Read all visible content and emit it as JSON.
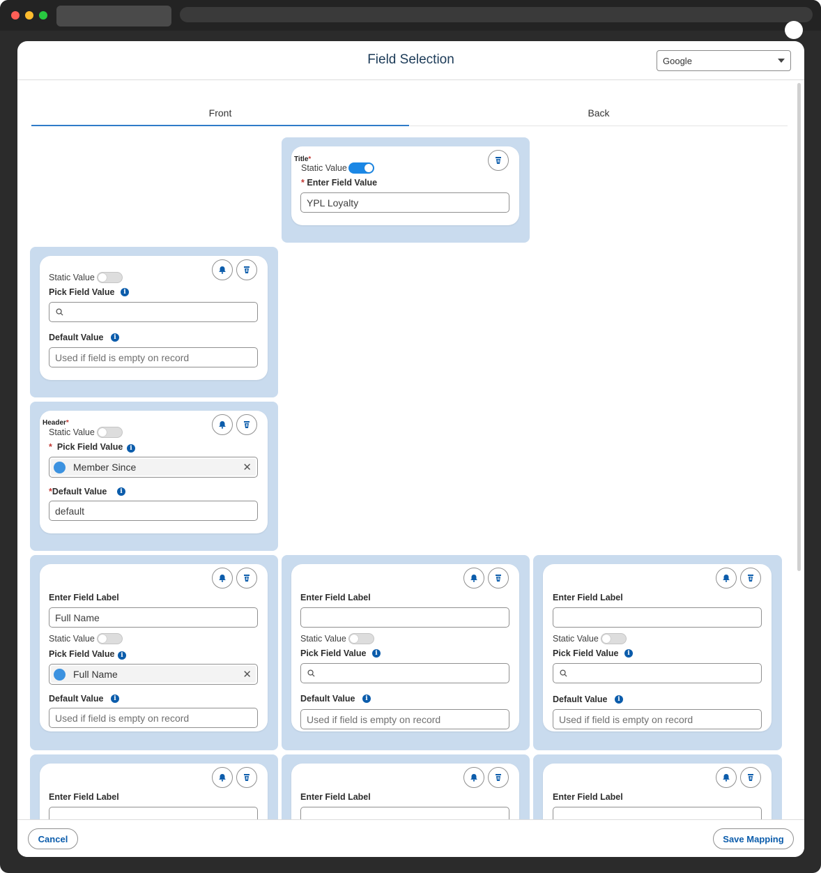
{
  "modal": {
    "title": "Field Selection",
    "platform_select": {
      "value": "Google"
    }
  },
  "tabs": [
    {
      "label": "Front",
      "active": true
    },
    {
      "label": "Back",
      "active": false
    }
  ],
  "labels": {
    "static_value": "Static Value",
    "pick_field_value": "Pick Field Value",
    "default_value": "Default Value",
    "enter_field_value": "Enter Field Value",
    "enter_field_label": "Enter Field Label",
    "required_mark": "*"
  },
  "placeholders": {
    "default_value": "Used if field is empty on record"
  },
  "cards": {
    "title_card": {
      "section": "Title",
      "static_value_on": true,
      "field_value": "YPL Loyalty"
    },
    "static_card": {
      "static_value_on": false
    },
    "header_card": {
      "section": "Header",
      "static_value_on": false,
      "picked_field": "Member Since",
      "default_value": "default"
    },
    "row1_col1": {
      "field_label": "Full Name",
      "picked_field": "Full Name"
    },
    "row1_col2": {
      "field_label": ""
    },
    "row1_col3": {
      "field_label": ""
    }
  },
  "icons": {
    "bell": "bell-icon",
    "trash": "trash-icon",
    "search": "search-icon",
    "info": "info-icon",
    "clear": "close-icon",
    "object": "object-icon",
    "dropdown": "chevron-down-icon"
  },
  "glyphs": {
    "info": "i",
    "clear": "✕"
  },
  "footer": {
    "cancel_label": "Cancel",
    "save_label": "Save Mapping"
  },
  "colors": {
    "accent": "#1b87e5",
    "block_bg": "#c9dbee",
    "button_text": "#0b5cab",
    "required": "#c23934"
  }
}
